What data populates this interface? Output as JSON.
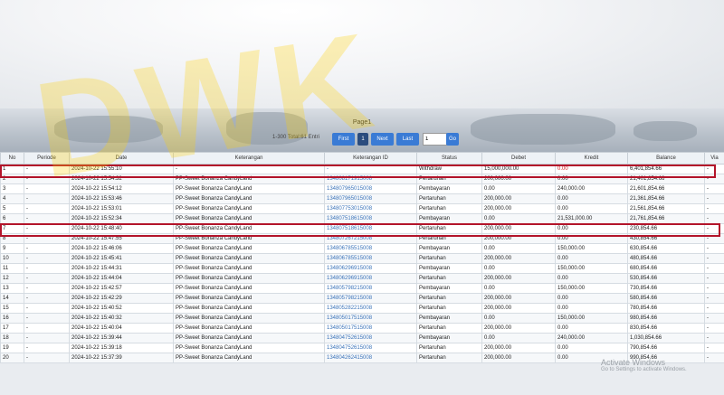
{
  "watermark_text": "DWK",
  "pager": {
    "title": "Page1",
    "info": "1-300 Total:61 Entri",
    "first": "First",
    "current": "1",
    "next": "Next",
    "last": "Last",
    "input_value": "1",
    "go": "Go"
  },
  "table": {
    "headers": [
      "No",
      "Periode",
      "Date",
      "Keterangan",
      "Keterangan ID",
      "Status",
      "Debet",
      "Kredit",
      "Balance",
      "Via"
    ],
    "rows": [
      [
        "1",
        "-",
        "2024-10-22 15:55:10",
        "-",
        "-",
        "Withdraw",
        "15,000,000.00",
        "0.00",
        "6,401,854.66",
        "-"
      ],
      [
        "2",
        "-",
        "2024-10-22 15:54:32",
        "PP-Sweet Bonanza CandyLand",
        "134808171915008",
        "Pertaruhan",
        "200,000.00",
        "0.00",
        "21,401,854.66",
        "-"
      ],
      [
        "3",
        "-",
        "2024-10-22 15:54:12",
        "PP-Sweet Bonanza CandyLand",
        "134807965015008",
        "Pembayaran",
        "0.00",
        "240,000.00",
        "21,601,854.66",
        "-"
      ],
      [
        "4",
        "-",
        "2024-10-22 15:53:46",
        "PP-Sweet Bonanza CandyLand",
        "134807965015008",
        "Pertaruhan",
        "200,000.00",
        "0.00",
        "21,361,854.66",
        "-"
      ],
      [
        "5",
        "-",
        "2024-10-22 15:53:01",
        "PP-Sweet Bonanza CandyLand",
        "134807753015008",
        "Pertaruhan",
        "200,000.00",
        "0.00",
        "21,561,854.66",
        "-"
      ],
      [
        "6",
        "-",
        "2024-10-22 15:52:34",
        "PP-Sweet Bonanza CandyLand",
        "134807518615008",
        "Pembayaran",
        "0.00",
        "21,531,000.00",
        "21,761,854.66",
        "-"
      ],
      [
        "7",
        "-",
        "2024-10-22 15:48:40",
        "PP-Sweet Bonanza CandyLand",
        "134807518615008",
        "Pertaruhan",
        "200,000.00",
        "0.00",
        "230,854.66",
        "-"
      ],
      [
        "8",
        "-",
        "2024-10-22 15:47:55",
        "PP-Sweet Bonanza CandyLand",
        "134807267215008",
        "Pertaruhan",
        "200,000.00",
        "0.00",
        "430,854.66",
        "-"
      ],
      [
        "9",
        "-",
        "2024-10-22 15:46:06",
        "PP-Sweet Bonanza CandyLand",
        "134806785515008",
        "Pembayaran",
        "0.00",
        "150,000.00",
        "630,854.66",
        "-"
      ],
      [
        "10",
        "-",
        "2024-10-22 15:45:41",
        "PP-Sweet Bonanza CandyLand",
        "134806785515008",
        "Pertaruhan",
        "200,000.00",
        "0.00",
        "480,854.66",
        "-"
      ],
      [
        "11",
        "-",
        "2024-10-22 15:44:31",
        "PP-Sweet Bonanza CandyLand",
        "134806296915008",
        "Pembayaran",
        "0.00",
        "150,000.00",
        "680,854.66",
        "-"
      ],
      [
        "12",
        "-",
        "2024-10-22 15:44:04",
        "PP-Sweet Bonanza CandyLand",
        "134806296915008",
        "Pertaruhan",
        "200,000.00",
        "0.00",
        "530,854.66",
        "-"
      ],
      [
        "13",
        "-",
        "2024-10-22 15:42:57",
        "PP-Sweet Bonanza CandyLand",
        "134805798215008",
        "Pembayaran",
        "0.00",
        "150,000.00",
        "730,854.66",
        "-"
      ],
      [
        "14",
        "-",
        "2024-10-22 15:42:29",
        "PP-Sweet Bonanza CandyLand",
        "134805798215008",
        "Pertaruhan",
        "200,000.00",
        "0.00",
        "580,854.66",
        "-"
      ],
      [
        "15",
        "-",
        "2024-10-22 15:40:52",
        "PP-Sweet Bonanza CandyLand",
        "134805282215008",
        "Pertaruhan",
        "200,000.00",
        "0.00",
        "780,854.66",
        "-"
      ],
      [
        "16",
        "-",
        "2024-10-22 15:40:32",
        "PP-Sweet Bonanza CandyLand",
        "134805017515008",
        "Pembayaran",
        "0.00",
        "150,000.00",
        "980,854.66",
        "-"
      ],
      [
        "17",
        "-",
        "2024-10-22 15:40:04",
        "PP-Sweet Bonanza CandyLand",
        "134805017515008",
        "Pertaruhan",
        "200,000.00",
        "0.00",
        "830,854.66",
        "-"
      ],
      [
        "18",
        "-",
        "2024-10-22 15:39:44",
        "PP-Sweet Bonanza CandyLand",
        "134804752615008",
        "Pembayaran",
        "0.00",
        "240,000.00",
        "1,030,854.66",
        "-"
      ],
      [
        "19",
        "-",
        "2024-10-22 15:39:18",
        "PP-Sweet Bonanza CandyLand",
        "134804752615008",
        "Pertaruhan",
        "200,000.00",
        "0.00",
        "790,854.66",
        "-"
      ],
      [
        "20",
        "-",
        "2024-10-22 15:37:39",
        "PP-Sweet Bonanza CandyLand",
        "134804262415008",
        "Pertaruhan",
        "200,000.00",
        "0.00",
        "990,854.66",
        "-"
      ]
    ]
  },
  "activation": {
    "title": "Activate Windows",
    "subtitle": "Go to Settings to activate Windows."
  },
  "colors": {
    "highlight": "#b3142a",
    "link": "#3b73b9",
    "button": "#3a7bd5"
  }
}
